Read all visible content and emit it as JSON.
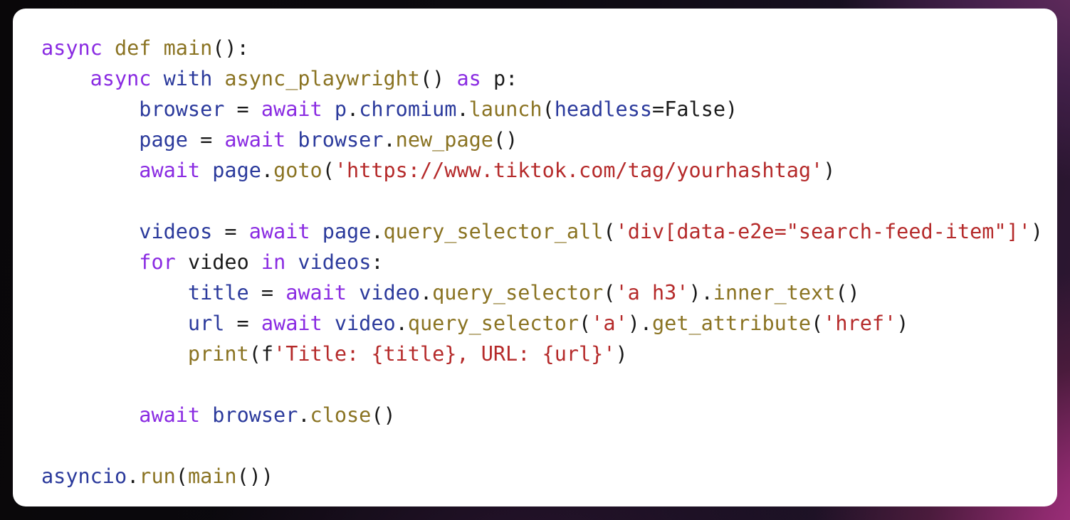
{
  "window": {
    "background_colors": [
      "#090709",
      "#2e1733",
      "#c03a96"
    ],
    "card_background": "#ffffff"
  },
  "theme": {
    "keyword_color": "#8a2be2",
    "function_color": "#8a7322",
    "name_color": "#2b3a9c",
    "string_color": "#b52a2a",
    "punctuation_color": "#1a1a1a",
    "language": "python"
  },
  "code": {
    "plain_text": "async def main():\n    async with async_playwright() as p:\n        browser = await p.chromium.launch(headless=False)\n        page = await browser.new_page()\n        await page.goto('https://www.tiktok.com/tag/yourhashtag')\n\n        videos = await page.query_selector_all('div[data-e2e=\"search-feed-item\"]')\n        for video in videos:\n            title = await video.query_selector('a h3').inner_text()\n            url = await video.query_selector('a').get_attribute('href')\n            print(f'Title: {title}, URL: {url}')\n\n        await browser.close()\n\nasyncio.run(main())",
    "lines": [
      {
        "n": 1,
        "indent": 0,
        "tokens": [
          {
            "t": "async",
            "c": "kw"
          },
          {
            "t": " ",
            "c": "pn"
          },
          {
            "t": "def",
            "c": "fn"
          },
          {
            "t": " ",
            "c": "pn"
          },
          {
            "t": "main",
            "c": "fn"
          },
          {
            "t": "():",
            "c": "pn"
          }
        ]
      },
      {
        "n": 2,
        "indent": 4,
        "tokens": [
          {
            "t": "async",
            "c": "kw"
          },
          {
            "t": " ",
            "c": "pn"
          },
          {
            "t": "with",
            "c": "nm"
          },
          {
            "t": " ",
            "c": "pn"
          },
          {
            "t": "async_playwright",
            "c": "fn"
          },
          {
            "t": "() ",
            "c": "pn"
          },
          {
            "t": "as",
            "c": "kw"
          },
          {
            "t": " ",
            "c": "pn"
          },
          {
            "t": "p",
            "c": "pn"
          },
          {
            "t": ":",
            "c": "pn"
          }
        ]
      },
      {
        "n": 3,
        "indent": 8,
        "tokens": [
          {
            "t": "browser",
            "c": "nm"
          },
          {
            "t": " = ",
            "c": "pn"
          },
          {
            "t": "await",
            "c": "kw"
          },
          {
            "t": " ",
            "c": "pn"
          },
          {
            "t": "p",
            "c": "nm"
          },
          {
            "t": ".",
            "c": "pn"
          },
          {
            "t": "chromium",
            "c": "nm"
          },
          {
            "t": ".",
            "c": "pn"
          },
          {
            "t": "launch",
            "c": "fn"
          },
          {
            "t": "(",
            "c": "pn"
          },
          {
            "t": "headless",
            "c": "nm"
          },
          {
            "t": "=",
            "c": "pn"
          },
          {
            "t": "False",
            "c": "bi"
          },
          {
            "t": ")",
            "c": "pn"
          }
        ]
      },
      {
        "n": 4,
        "indent": 8,
        "tokens": [
          {
            "t": "page",
            "c": "nm"
          },
          {
            "t": " = ",
            "c": "pn"
          },
          {
            "t": "await",
            "c": "kw"
          },
          {
            "t": " ",
            "c": "pn"
          },
          {
            "t": "browser",
            "c": "nm"
          },
          {
            "t": ".",
            "c": "pn"
          },
          {
            "t": "new_page",
            "c": "fn"
          },
          {
            "t": "()",
            "c": "pn"
          }
        ]
      },
      {
        "n": 5,
        "indent": 8,
        "tokens": [
          {
            "t": "await",
            "c": "kw"
          },
          {
            "t": " ",
            "c": "pn"
          },
          {
            "t": "page",
            "c": "nm"
          },
          {
            "t": ".",
            "c": "pn"
          },
          {
            "t": "goto",
            "c": "fn"
          },
          {
            "t": "(",
            "c": "pn"
          },
          {
            "t": "'https://www.tiktok.com/tag/yourhashtag'",
            "c": "str"
          },
          {
            "t": ")",
            "c": "pn"
          }
        ]
      },
      {
        "n": 6,
        "indent": 0,
        "tokens": []
      },
      {
        "n": 7,
        "indent": 8,
        "tokens": [
          {
            "t": "videos",
            "c": "nm"
          },
          {
            "t": " = ",
            "c": "pn"
          },
          {
            "t": "await",
            "c": "kw"
          },
          {
            "t": " ",
            "c": "pn"
          },
          {
            "t": "page",
            "c": "nm"
          },
          {
            "t": ".",
            "c": "pn"
          },
          {
            "t": "query_selector_all",
            "c": "fn"
          },
          {
            "t": "(",
            "c": "pn"
          },
          {
            "t": "'div[data-e2e=\"search-feed-item\"]'",
            "c": "str"
          },
          {
            "t": ")",
            "c": "pn"
          }
        ]
      },
      {
        "n": 8,
        "indent": 8,
        "tokens": [
          {
            "t": "for",
            "c": "kw"
          },
          {
            "t": " ",
            "c": "pn"
          },
          {
            "t": "video",
            "c": "pn"
          },
          {
            "t": " ",
            "c": "pn"
          },
          {
            "t": "in",
            "c": "kw"
          },
          {
            "t": " ",
            "c": "pn"
          },
          {
            "t": "videos",
            "c": "nm"
          },
          {
            "t": ":",
            "c": "pn"
          }
        ]
      },
      {
        "n": 9,
        "indent": 12,
        "tokens": [
          {
            "t": "title",
            "c": "nm"
          },
          {
            "t": " = ",
            "c": "pn"
          },
          {
            "t": "await",
            "c": "kw"
          },
          {
            "t": " ",
            "c": "pn"
          },
          {
            "t": "video",
            "c": "nm"
          },
          {
            "t": ".",
            "c": "pn"
          },
          {
            "t": "query_selector",
            "c": "fn"
          },
          {
            "t": "(",
            "c": "pn"
          },
          {
            "t": "'a h3'",
            "c": "str"
          },
          {
            "t": ").",
            "c": "pn"
          },
          {
            "t": "inner_text",
            "c": "fn"
          },
          {
            "t": "()",
            "c": "pn"
          }
        ]
      },
      {
        "n": 10,
        "indent": 12,
        "tokens": [
          {
            "t": "url",
            "c": "nm"
          },
          {
            "t": " = ",
            "c": "pn"
          },
          {
            "t": "await",
            "c": "kw"
          },
          {
            "t": " ",
            "c": "pn"
          },
          {
            "t": "video",
            "c": "nm"
          },
          {
            "t": ".",
            "c": "pn"
          },
          {
            "t": "query_selector",
            "c": "fn"
          },
          {
            "t": "(",
            "c": "pn"
          },
          {
            "t": "'a'",
            "c": "str"
          },
          {
            "t": ").",
            "c": "pn"
          },
          {
            "t": "get_attribute",
            "c": "fn"
          },
          {
            "t": "(",
            "c": "pn"
          },
          {
            "t": "'href'",
            "c": "str"
          },
          {
            "t": ")",
            "c": "pn"
          }
        ]
      },
      {
        "n": 11,
        "indent": 12,
        "tokens": [
          {
            "t": "print",
            "c": "fn"
          },
          {
            "t": "(",
            "c": "pn"
          },
          {
            "t": "f",
            "c": "pn"
          },
          {
            "t": "'Title: {title}, URL: {url}'",
            "c": "str"
          },
          {
            "t": ")",
            "c": "pn"
          }
        ]
      },
      {
        "n": 12,
        "indent": 0,
        "tokens": []
      },
      {
        "n": 13,
        "indent": 8,
        "tokens": [
          {
            "t": "await",
            "c": "kw"
          },
          {
            "t": " ",
            "c": "pn"
          },
          {
            "t": "browser",
            "c": "nm"
          },
          {
            "t": ".",
            "c": "pn"
          },
          {
            "t": "close",
            "c": "fn"
          },
          {
            "t": "()",
            "c": "pn"
          }
        ]
      },
      {
        "n": 14,
        "indent": 0,
        "tokens": []
      },
      {
        "n": 15,
        "indent": 0,
        "tokens": [
          {
            "t": "asyncio",
            "c": "nm"
          },
          {
            "t": ".",
            "c": "pn"
          },
          {
            "t": "run",
            "c": "fn"
          },
          {
            "t": "(",
            "c": "pn"
          },
          {
            "t": "main",
            "c": "fn"
          },
          {
            "t": "())",
            "c": "pn"
          }
        ]
      }
    ]
  }
}
